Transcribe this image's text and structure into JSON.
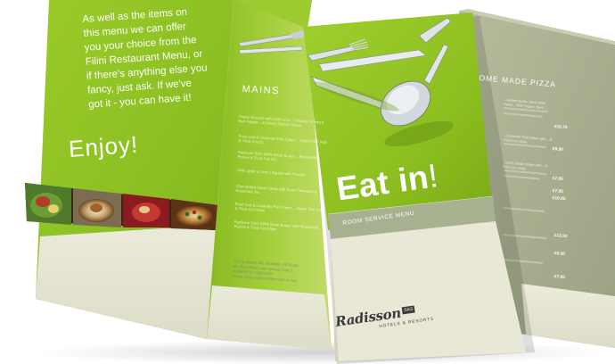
{
  "colors": {
    "lime_green": "#8dc021",
    "light_green": "#b3d453",
    "sage_grey": "#a8b190",
    "cream": "#ecebdb",
    "dark_text": "#3a3a3a"
  },
  "left_panel": {
    "intro_lines": [
      "As well as the items on",
      "this menu we can offer",
      "you your choice from the",
      "Filini Restaurant Menu, or",
      "if there's anything else you",
      "fancy, just ask. If we've",
      "got it - you can have it!"
    ],
    "enjoy": "Enjoy!"
  },
  "mains_panel": {
    "heading": "MAINS",
    "items": [
      "Potato Gnocchi with Chat Grou... Chicken, Roasted Red Pepper... & Cherry Tomato Sauce",
      "Fried Cod & Coriander Fish Cakes... Sweet Thai Jelly & Thick Cut Ch...",
      "Radisson SAS 100% Steak Burger... Mozzarella, Pickles & Thick Cut Ch...",
      "Chilli, garlic & Lime Linguine with Prawns",
      "Char Grilled Sirloin Steak with Roast Tomatoes & Rosemary Jus",
      "Fried Cod & Coriander Fish Cakes... Sweet Thai Jelly & Thick Cut Chips",
      "Radisson SAS 100% Steak Burger with Mozzarella, Pickles & Thick Cut Chips"
    ],
    "notes": [
      "These dishes are available 24 Hours",
      "all other dishes are served from 1...",
      "Suitable for vegetarian",
      "Some items may contain nuts or nut..."
    ]
  },
  "cover": {
    "title_main": "Eat in",
    "title_excl": "!",
    "subtitle": "ROOM SERVICE MENU",
    "brand": "Radisson",
    "brand_badge": "SAS",
    "brand_sub": "HOTELS & RESORTS"
  },
  "right_panel": {
    "heading": "OME MADE PIZZA",
    "prices": [
      "£10.75",
      "£9.50",
      "£7.95",
      "£7.95",
      "£10.95",
      "£13.50",
      "£9.50",
      "£7.95"
    ],
    "items": [
      "...oasted Garlic, Olive Oiled Pesto... Red Pepper, Basil...",
      "...Coriander Fish Cakes with... & Thick Cut Chips",
      "...100% Steak Burger with... & Thick Cut Chips"
    ]
  }
}
